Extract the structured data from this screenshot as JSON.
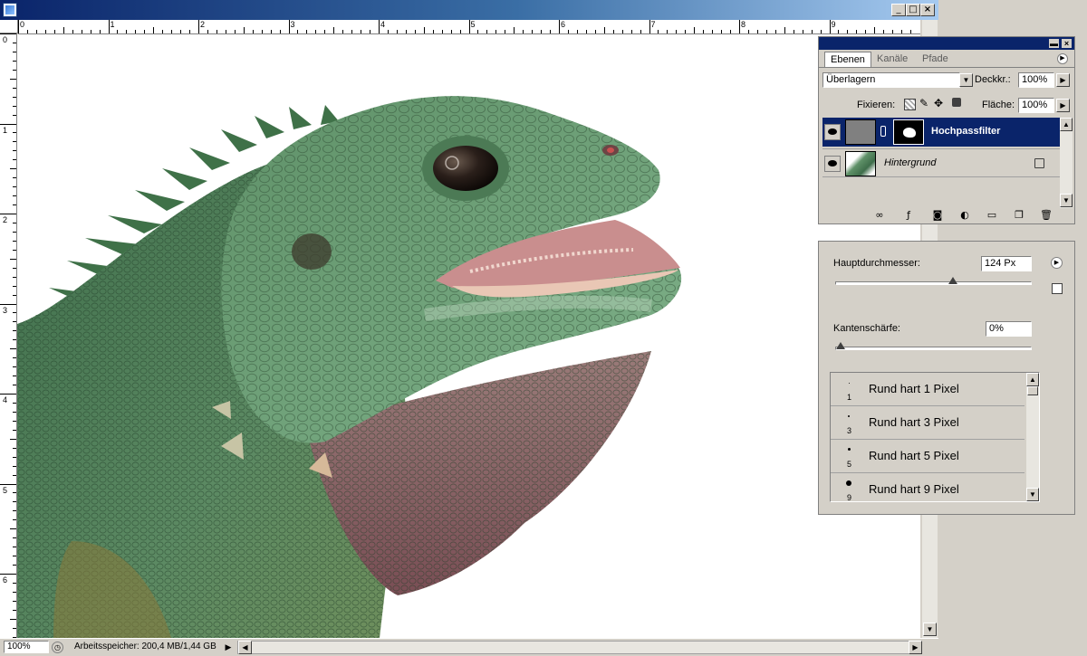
{
  "window": {
    "title": ""
  },
  "rulers": {
    "horizontal": [
      "0",
      "1",
      "2",
      "3",
      "4",
      "5",
      "6",
      "7",
      "8",
      "9"
    ],
    "vertical": [
      "0",
      "1",
      "2",
      "3",
      "4",
      "5",
      "6"
    ]
  },
  "status": {
    "zoom": "100%",
    "memory": "Arbeitsspeicher: 200,4 MB/1,44 GB"
  },
  "layers_palette": {
    "tabs": [
      "Ebenen",
      "Kanäle",
      "Pfade"
    ],
    "blend_mode": "Überlagern",
    "opacity_label": "Deckkr.:",
    "opacity_value": "100%",
    "lock_label": "Fixieren:",
    "fill_label": "Fläche:",
    "fill_value": "100%",
    "layers": [
      {
        "name": "Hochpassfilter",
        "selected": true
      },
      {
        "name": "Hintergrund",
        "selected": false,
        "locked": true
      }
    ]
  },
  "brush_palette": {
    "diameter_label": "Hauptdurchmesser:",
    "diameter_value": "124 Px",
    "diameter_slider": 0.6,
    "hardness_label": "Kantenschärfe:",
    "hardness_value": "0%",
    "hardness_slider": 0.0,
    "presets": [
      {
        "name": "Rund hart 1 Pixel",
        "size": "1"
      },
      {
        "name": "Rund hart 3 Pixel",
        "size": "3"
      },
      {
        "name": "Rund hart 5 Pixel",
        "size": "5"
      },
      {
        "name": "Rund hart 9 Pixel",
        "size": "9"
      }
    ]
  },
  "colors": {
    "titlebar": "#0a246a",
    "selection": "#0a246a",
    "chrome": "#d4d0c8"
  }
}
